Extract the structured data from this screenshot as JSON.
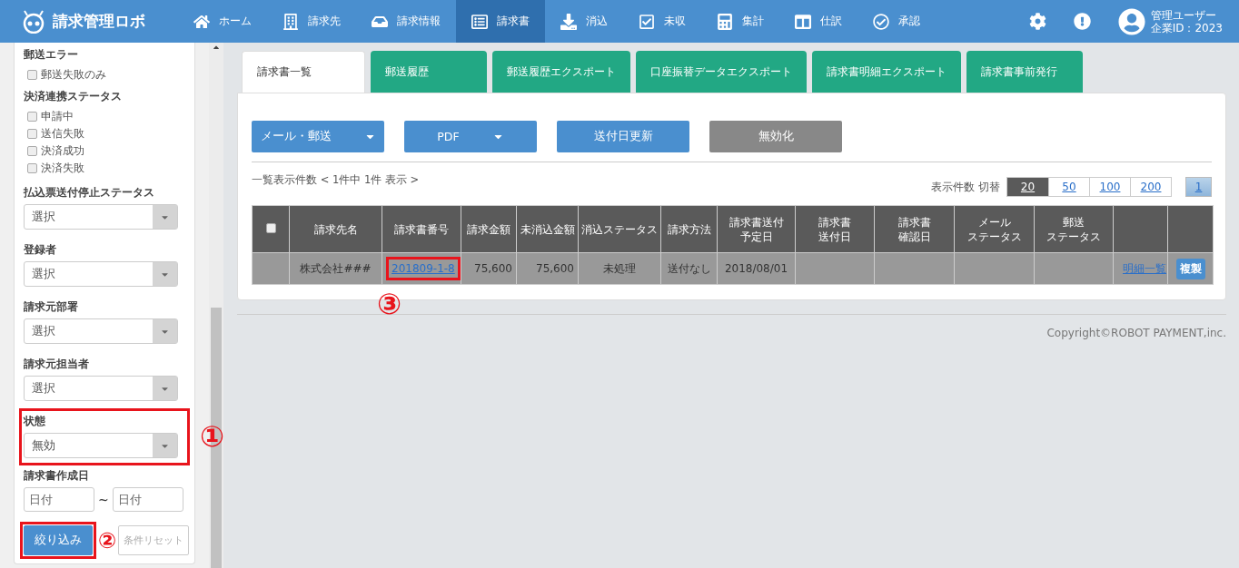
{
  "nav": {
    "brand": "請求管理ロボ",
    "items": [
      {
        "label": "ホーム",
        "selected": false
      },
      {
        "label": "請求先",
        "selected": false
      },
      {
        "label": "請求情報",
        "selected": false
      },
      {
        "label": "請求書",
        "selected": true
      },
      {
        "label": "消込",
        "selected": false
      },
      {
        "label": "未収",
        "selected": false
      },
      {
        "label": "集計",
        "selected": false
      },
      {
        "label": "仕訳",
        "selected": false
      },
      {
        "label": "承認",
        "selected": false
      }
    ],
    "user": {
      "name": "管理ユーザー",
      "company": "企業ID：2023"
    }
  },
  "sidebar": {
    "sections": [
      {
        "kind": "checks",
        "title": "郵送エラー",
        "options": [
          {
            "label": "郵送失敗のみ",
            "checked": false
          }
        ]
      },
      {
        "kind": "checks",
        "title": "決済連携ステータス",
        "options": [
          {
            "label": "申請中",
            "checked": false
          },
          {
            "label": "送信失敗",
            "checked": false
          },
          {
            "label": "決済成功",
            "checked": false
          },
          {
            "label": "決済失敗",
            "checked": false
          }
        ]
      },
      {
        "kind": "select",
        "title": "払込票送付停止ステータス",
        "value": "選択",
        "highlighted": false
      },
      {
        "kind": "select",
        "title": "登録者",
        "value": "選択",
        "highlighted": false
      },
      {
        "kind": "select",
        "title": "請求元部署",
        "value": "選択",
        "highlighted": false
      },
      {
        "kind": "select",
        "title": "請求元担当者",
        "value": "選択",
        "highlighted": false
      },
      {
        "kind": "select",
        "title": "状態",
        "value": "無効",
        "highlighted": true,
        "badge": "①"
      },
      {
        "kind": "dates",
        "title": "請求書作成日",
        "fields": [
          {
            "placeholder": "日付"
          },
          {
            "placeholder": "日付"
          }
        ],
        "separator": "~"
      }
    ],
    "buttons": [
      {
        "kind": "primary",
        "label": "絞り込み",
        "highlighted": true,
        "badge": "②"
      },
      {
        "kind": "secondary",
        "label": "条件リセット",
        "highlighted": false
      }
    ]
  },
  "tabs": [
    {
      "label": "請求書一覧",
      "selected": true
    },
    {
      "label": "郵送履歴",
      "selected": false
    },
    {
      "label": "郵送履歴エクスポート",
      "selected": false
    },
    {
      "label": "口座振替データエクスポート",
      "selected": false
    },
    {
      "label": "請求書明細エクスポート",
      "selected": false
    },
    {
      "label": "請求書事前発行",
      "selected": false
    }
  ],
  "actions": [
    {
      "kind": "dropdown",
      "label": "メール・郵送"
    },
    {
      "kind": "dropdown",
      "label": "PDF"
    },
    {
      "kind": "primary",
      "label": "送付日更新"
    },
    {
      "kind": "muted",
      "label": "無効化"
    }
  ],
  "summary": "一覧表示件数 < 1件中 1件 表示 >",
  "page_size": {
    "label": "表示件数 切替",
    "options": [
      {
        "label": "20",
        "selected": true
      },
      {
        "label": "50",
        "selected": false
      },
      {
        "label": "100",
        "selected": false
      },
      {
        "label": "200",
        "selected": false
      }
    ]
  },
  "pages": [
    {
      "label": "1",
      "selected": true
    }
  ],
  "table": {
    "select_all": {
      "checked": false
    },
    "columns": [
      {
        "lines": [
          "請求先名"
        ]
      },
      {
        "lines": [
          "請求書番号"
        ]
      },
      {
        "lines": [
          "請求金額"
        ]
      },
      {
        "lines": [
          "未消込金額"
        ]
      },
      {
        "lines": [
          "消込ステータス"
        ]
      },
      {
        "lines": [
          "請求方法"
        ]
      },
      {
        "lines": [
          "請求書送付",
          "予定日"
        ]
      },
      {
        "lines": [
          "請求書",
          "送付日"
        ]
      },
      {
        "lines": [
          "請求書",
          "確認日"
        ]
      },
      {
        "lines": [
          "メール",
          "ステータス"
        ]
      },
      {
        "lines": [
          "郵送",
          "ステータス"
        ]
      },
      {},
      {}
    ],
    "rows": [
      {
        "cells": [
          {
            "kind": "text",
            "text": "株式会社###"
          },
          {
            "kind": "link",
            "text": "201809-1-8",
            "highlighted": true,
            "badge": "③"
          },
          {
            "kind": "number",
            "text": "75,600"
          },
          {
            "kind": "number",
            "text": "75,600"
          },
          {
            "kind": "text",
            "text": "未処理"
          },
          {
            "kind": "text",
            "text": "送付なし"
          },
          {
            "kind": "text",
            "text": "2018/08/01"
          },
          {
            "kind": "empty"
          },
          {
            "kind": "empty"
          },
          {
            "kind": "empty"
          },
          {
            "kind": "empty"
          },
          {
            "kind": "link",
            "text": "明細一覧",
            "highlighted": false
          },
          {
            "kind": "button",
            "text": "複製"
          }
        ]
      }
    ]
  },
  "footer": "Copyright©ROBOT PAYMENT,inc."
}
